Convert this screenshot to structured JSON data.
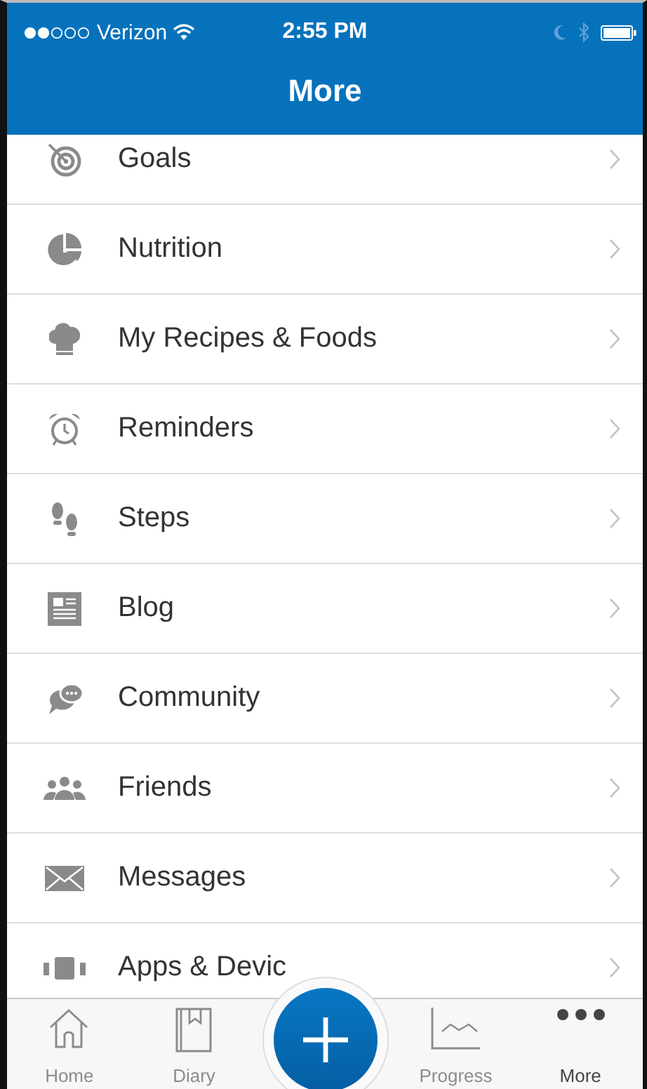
{
  "status_bar": {
    "carrier": "Verizon",
    "time": "2:55 PM"
  },
  "header": {
    "title": "More"
  },
  "menu": [
    {
      "kind": "goals",
      "label": "Goals"
    },
    {
      "kind": "nutrition",
      "label": "Nutrition"
    },
    {
      "kind": "recipes",
      "label": "My Recipes & Foods"
    },
    {
      "kind": "reminders",
      "label": "Reminders"
    },
    {
      "kind": "steps",
      "label": "Steps"
    },
    {
      "kind": "blog",
      "label": "Blog"
    },
    {
      "kind": "community",
      "label": "Community"
    },
    {
      "kind": "friends",
      "label": "Friends"
    },
    {
      "kind": "messages",
      "label": "Messages"
    },
    {
      "kind": "apps",
      "label": "Apps & Devic"
    }
  ],
  "tab_bar": [
    {
      "kind": "home",
      "label": "Home",
      "selected": false
    },
    {
      "kind": "diary",
      "label": "Diary",
      "selected": false
    },
    {
      "kind": "add"
    },
    {
      "kind": "progress",
      "label": "Progress",
      "selected": false
    },
    {
      "kind": "more",
      "label": "More",
      "selected": true
    }
  ]
}
